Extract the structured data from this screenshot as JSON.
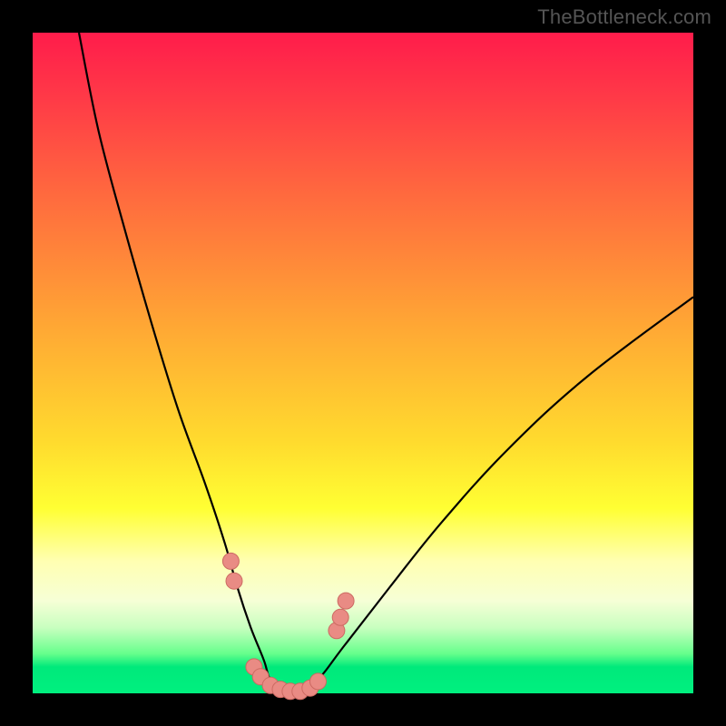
{
  "watermark": "TheBottleneck.com",
  "colors": {
    "gradient_top": "#ff1c4b",
    "gradient_mid": "#ffff33",
    "gradient_bottom": "#00e97b",
    "curve": "#000000",
    "marker_fill": "#e98b84",
    "marker_stroke": "#cc6a62",
    "frame": "#000000"
  },
  "chart_data": {
    "type": "line",
    "title": "",
    "xlabel": "",
    "ylabel": "",
    "xlim": [
      0,
      100
    ],
    "ylim": [
      0,
      100
    ],
    "grid": false,
    "legend": false,
    "description": "V-shaped bottleneck curve over a vertical red→orange→yellow→green gradient. Curve descends from ~100% at x≈7 to ~0% near x≈36, stays near 0 until x≈42, then rises to ~60% at x≈100.",
    "series": [
      {
        "name": "bottleneck-curve",
        "x": [
          7,
          10,
          14,
          18,
          22,
          26,
          29,
          31,
          33,
          35,
          36,
          38,
          40,
          42,
          44,
          47,
          54,
          62,
          72,
          84,
          100
        ],
        "values": [
          100,
          85,
          70,
          56,
          43,
          32,
          23,
          16,
          10,
          5,
          2,
          0,
          0,
          1,
          3,
          7,
          16,
          26,
          37,
          48,
          60
        ]
      }
    ],
    "markers": [
      {
        "x": 30.0,
        "y": 20.0
      },
      {
        "x": 30.5,
        "y": 17.0
      },
      {
        "x": 33.5,
        "y": 4.0
      },
      {
        "x": 34.5,
        "y": 2.5
      },
      {
        "x": 36.0,
        "y": 1.2
      },
      {
        "x": 37.5,
        "y": 0.6
      },
      {
        "x": 39.0,
        "y": 0.3
      },
      {
        "x": 40.5,
        "y": 0.3
      },
      {
        "x": 42.0,
        "y": 0.8
      },
      {
        "x": 43.2,
        "y": 1.8
      },
      {
        "x": 46.0,
        "y": 9.5
      },
      {
        "x": 46.6,
        "y": 11.5
      },
      {
        "x": 47.4,
        "y": 14.0
      }
    ]
  }
}
